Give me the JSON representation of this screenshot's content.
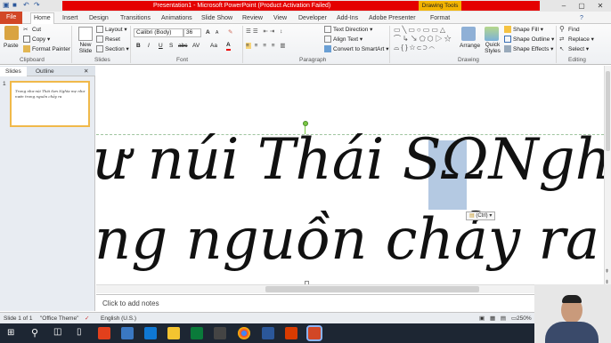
{
  "window": {
    "title": "Presentation1 - Microsoft PowerPoint (Product Activation Failed)",
    "context_tab": "Drawing Tools"
  },
  "tabs": [
    "File",
    "Home",
    "Insert",
    "Design",
    "Transitions",
    "Animations",
    "Slide Show",
    "Review",
    "View",
    "Developer",
    "Add-Ins",
    "Adobe Presenter",
    "Format"
  ],
  "ribbon": {
    "clipboard": {
      "paste": "Paste",
      "cut": "Cut",
      "copy": "Copy",
      "format_painter": "Format Painter",
      "label": "Clipboard"
    },
    "slides": {
      "new_slide": "New Slide",
      "layout": "Layout",
      "reset": "Reset",
      "section": "Section",
      "label": "Slides"
    },
    "font": {
      "font_name": "Calibri (Body)",
      "font_size": "36",
      "label": "Font",
      "bold": "B",
      "italic": "I",
      "underline": "U",
      "strike": "S",
      "shadow": "abc",
      "spacing": "AV",
      "case": "Aa",
      "color": "A",
      "grow": "A",
      "shrink": "A"
    },
    "paragraph": {
      "text_direction": "Text Direction",
      "align_text": "Align Text",
      "convert_smartart": "Convert to SmartArt",
      "label": "Paragraph"
    },
    "drawing": {
      "arrange": "Arrange",
      "quick_styles": "Quick Styles",
      "shape_fill": "Shape Fill",
      "shape_outline": "Shape Outline",
      "shape_effects": "Shape Effects",
      "label": "Drawing"
    },
    "editing": {
      "find": "Find",
      "replace": "Replace",
      "select": "Select",
      "label": "Editing"
    }
  },
  "left_pane": {
    "tab_slides": "Slides",
    "tab_outline": "Outline",
    "slide_number": "1",
    "thumb_text": "Trong như núi Thái Sơn Nghĩa mẹ như nước trong nguồn chảy ra"
  },
  "slide": {
    "line1": "ư núi Thái SΩNghĩ",
    "line2": "ng nguồn chảy ra",
    "selected_char": "Ω",
    "paste_options": "(Ctrl)"
  },
  "notes": {
    "placeholder": "Click to add notes"
  },
  "status": {
    "slide": "Slide 1 of 1",
    "theme": "\"Office Theme\"",
    "language": "English (U.S.)",
    "zoom": "250%"
  },
  "colors": {
    "file_tab": "#d24726",
    "title_red": "#e40000",
    "context": "#f2b300"
  }
}
